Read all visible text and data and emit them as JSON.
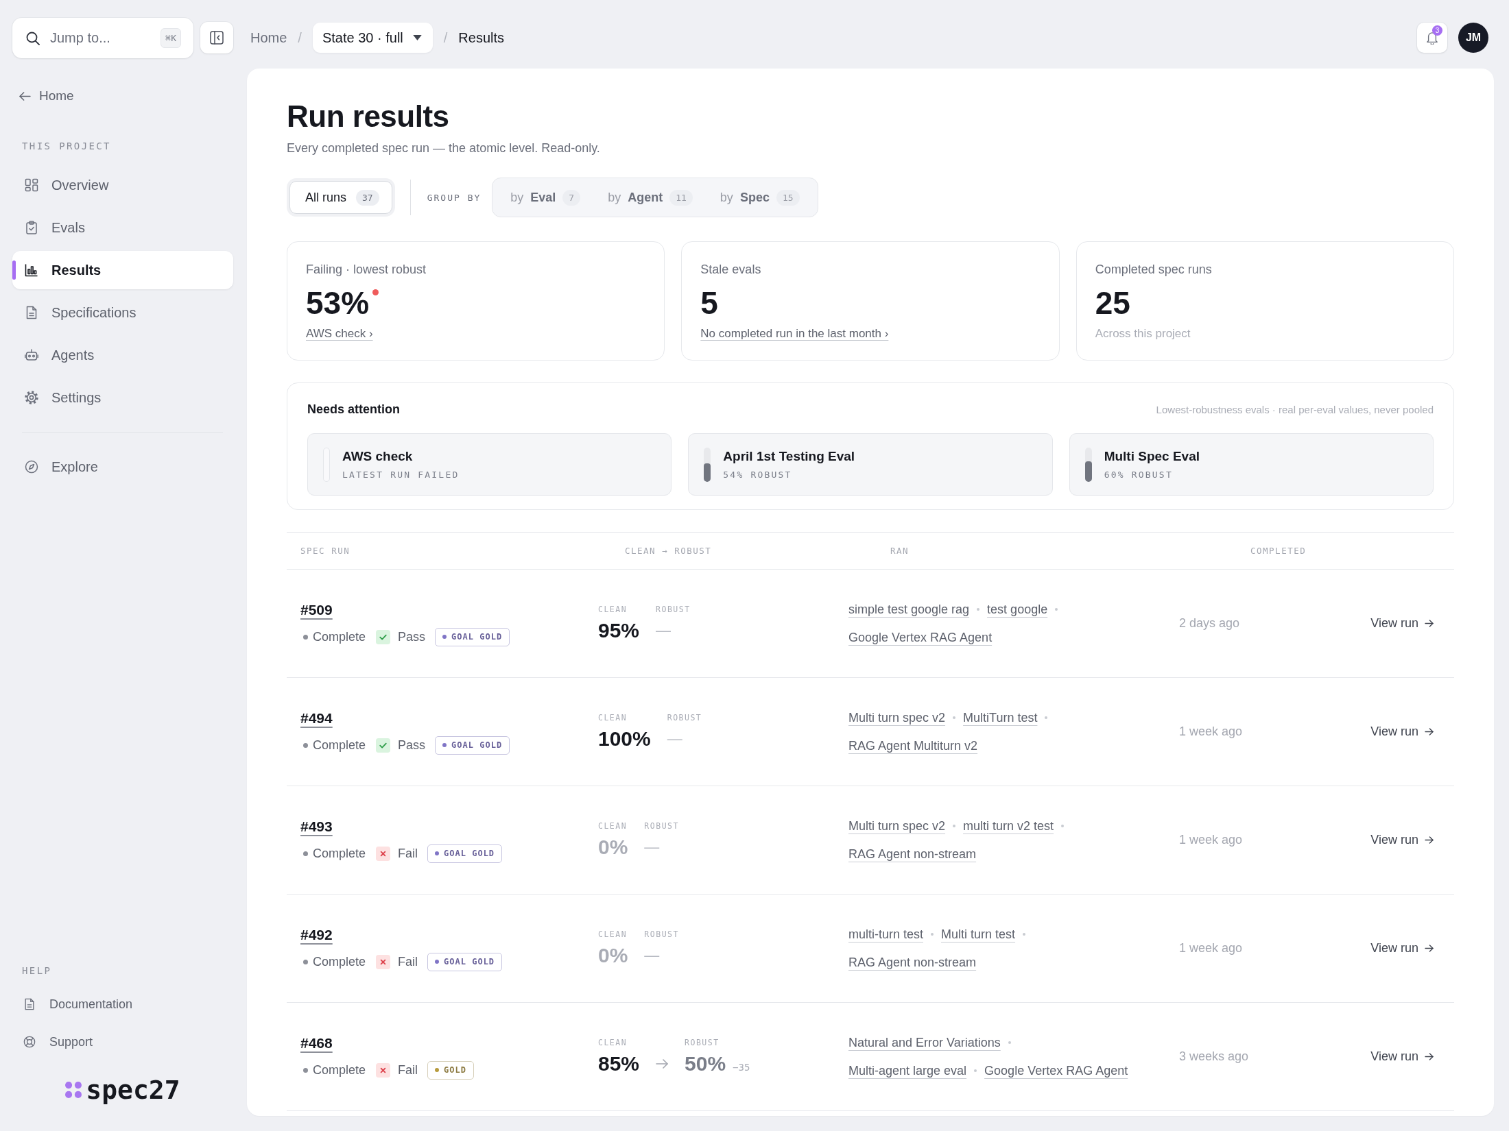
{
  "topbar": {
    "search": {
      "placeholder": "Jump to...",
      "shortcut": "⌘K"
    },
    "breadcrumbs": [
      {
        "label": "Home",
        "kind": "link"
      },
      {
        "label": "/",
        "kind": "separator"
      },
      {
        "label": "State 30 · full",
        "kind": "dropdown"
      },
      {
        "label": "/",
        "kind": "separator"
      },
      {
        "label": "Results",
        "kind": "current"
      }
    ],
    "notifications": {
      "count": "3"
    },
    "avatar": {
      "initials": "JM"
    }
  },
  "sidebar": {
    "back_link": "Home",
    "project_section": {
      "title": "THIS PROJECT",
      "items": [
        {
          "label": "Overview",
          "selected": false
        },
        {
          "label": "Evals",
          "selected": false
        },
        {
          "label": "Results",
          "selected": true
        },
        {
          "label": "Specifications",
          "selected": false
        },
        {
          "label": "Agents",
          "selected": false
        },
        {
          "label": "Settings",
          "selected": false
        }
      ]
    },
    "more_items": [
      {
        "label": "Explore",
        "selected": false
      }
    ],
    "help_section": {
      "title": "HELP",
      "items": [
        "Documentation",
        "Support"
      ]
    },
    "logo": "spec27"
  },
  "page": {
    "title": "Run results",
    "subtitle": "Every completed spec run — the atomic level. Read-only."
  },
  "view_tabs": [
    {
      "label": "All runs",
      "count": "37",
      "selected": true
    }
  ],
  "group_by": {
    "label": "GROUP BY",
    "options": [
      {
        "prefix": "by",
        "label": "Eval",
        "count": "7",
        "selected": false
      },
      {
        "prefix": "by",
        "label": "Agent",
        "count": "11",
        "selected": false
      },
      {
        "prefix": "by",
        "label": "Spec",
        "count": "15",
        "selected": false
      }
    ]
  },
  "stat_cards": [
    {
      "label": "Failing · lowest robust",
      "value": "53%",
      "alert": true,
      "link": "AWS check ›"
    },
    {
      "label": "Stale evals",
      "value": "5",
      "alert": false,
      "link": "No completed run in the last month ›"
    },
    {
      "label": "Completed spec runs",
      "value": "25",
      "alert": false,
      "note": "Across this project"
    }
  ],
  "needs_attention": {
    "title": "Needs attention",
    "note": "Lowest-robustness evals · real per-eval values, never pooled",
    "items": [
      {
        "name": "AWS check",
        "status": "LATEST RUN FAILED",
        "level": 0
      },
      {
        "name": "April 1st Testing Eval",
        "status": "54% ROBUST",
        "level": 0.54
      },
      {
        "name": "Multi Spec Eval",
        "status": "60% ROBUST",
        "level": 0.6
      }
    ]
  },
  "table": {
    "columns": [
      "SPEC RUN",
      "CLEAN → ROBUST",
      "RAN",
      "COMPLETED"
    ],
    "rows": [
      {
        "id": "#509",
        "status": "Complete",
        "result": {
          "label": "Pass",
          "passed": true
        },
        "tag": {
          "label": "GOAL GOLD",
          "color": "#8075c6"
        },
        "clean": {
          "label": "CLEAN",
          "value": "95%",
          "muted": false
        },
        "robust": {
          "label": "ROBUST",
          "value": "—",
          "kind": "empty"
        },
        "ran": [
          [
            "simple test google rag",
            "test google"
          ],
          [
            "Google Vertex RAG Agent"
          ]
        ],
        "completed": "2 days ago",
        "action": "View run"
      },
      {
        "id": "#494",
        "status": "Complete",
        "result": {
          "label": "Pass",
          "passed": true
        },
        "tag": {
          "label": "GOAL GOLD",
          "color": "#8075c6"
        },
        "clean": {
          "label": "CLEAN",
          "value": "100%",
          "muted": false
        },
        "robust": {
          "label": "ROBUST",
          "value": "—",
          "kind": "empty"
        },
        "ran": [
          [
            "Multi turn spec v2",
            "MultiTurn test"
          ],
          [
            "RAG Agent Multiturn v2"
          ]
        ],
        "completed": "1 week ago",
        "action": "View run"
      },
      {
        "id": "#493",
        "status": "Complete",
        "result": {
          "label": "Fail",
          "passed": false
        },
        "tag": {
          "label": "GOAL GOLD",
          "color": "#8075c6"
        },
        "clean": {
          "label": "CLEAN",
          "value": "0%",
          "muted": true
        },
        "robust": {
          "label": "ROBUST",
          "value": "—",
          "kind": "empty"
        },
        "ran": [
          [
            "Multi turn spec v2",
            "multi turn v2 test"
          ],
          [
            "RAG Agent non-stream"
          ]
        ],
        "completed": "1 week ago",
        "action": "View run"
      },
      {
        "id": "#492",
        "status": "Complete",
        "result": {
          "label": "Fail",
          "passed": false
        },
        "tag": {
          "label": "GOAL GOLD",
          "color": "#8075c6"
        },
        "clean": {
          "label": "CLEAN",
          "value": "0%",
          "muted": true
        },
        "robust": {
          "label": "ROBUST",
          "value": "—",
          "kind": "empty"
        },
        "ran": [
          [
            "multi-turn test",
            "Multi turn test"
          ],
          [
            "RAG Agent non-stream"
          ]
        ],
        "completed": "1 week ago",
        "action": "View run"
      },
      {
        "id": "#468",
        "status": "Complete",
        "result": {
          "label": "Fail",
          "passed": false
        },
        "tag": {
          "label": "GOLD",
          "color": "#b89c3e"
        },
        "clean": {
          "label": "CLEAN",
          "value": "85%",
          "muted": false
        },
        "robust": {
          "label": "ROBUST",
          "value": "50%",
          "kind": "score",
          "delta": "−35"
        },
        "ran": [
          [
            "Natural and Error Variations"
          ],
          [
            "Multi-agent large eval",
            "Google Vertex RAG Agent"
          ]
        ],
        "completed": "3 weeks ago",
        "action": "View run"
      }
    ]
  }
}
